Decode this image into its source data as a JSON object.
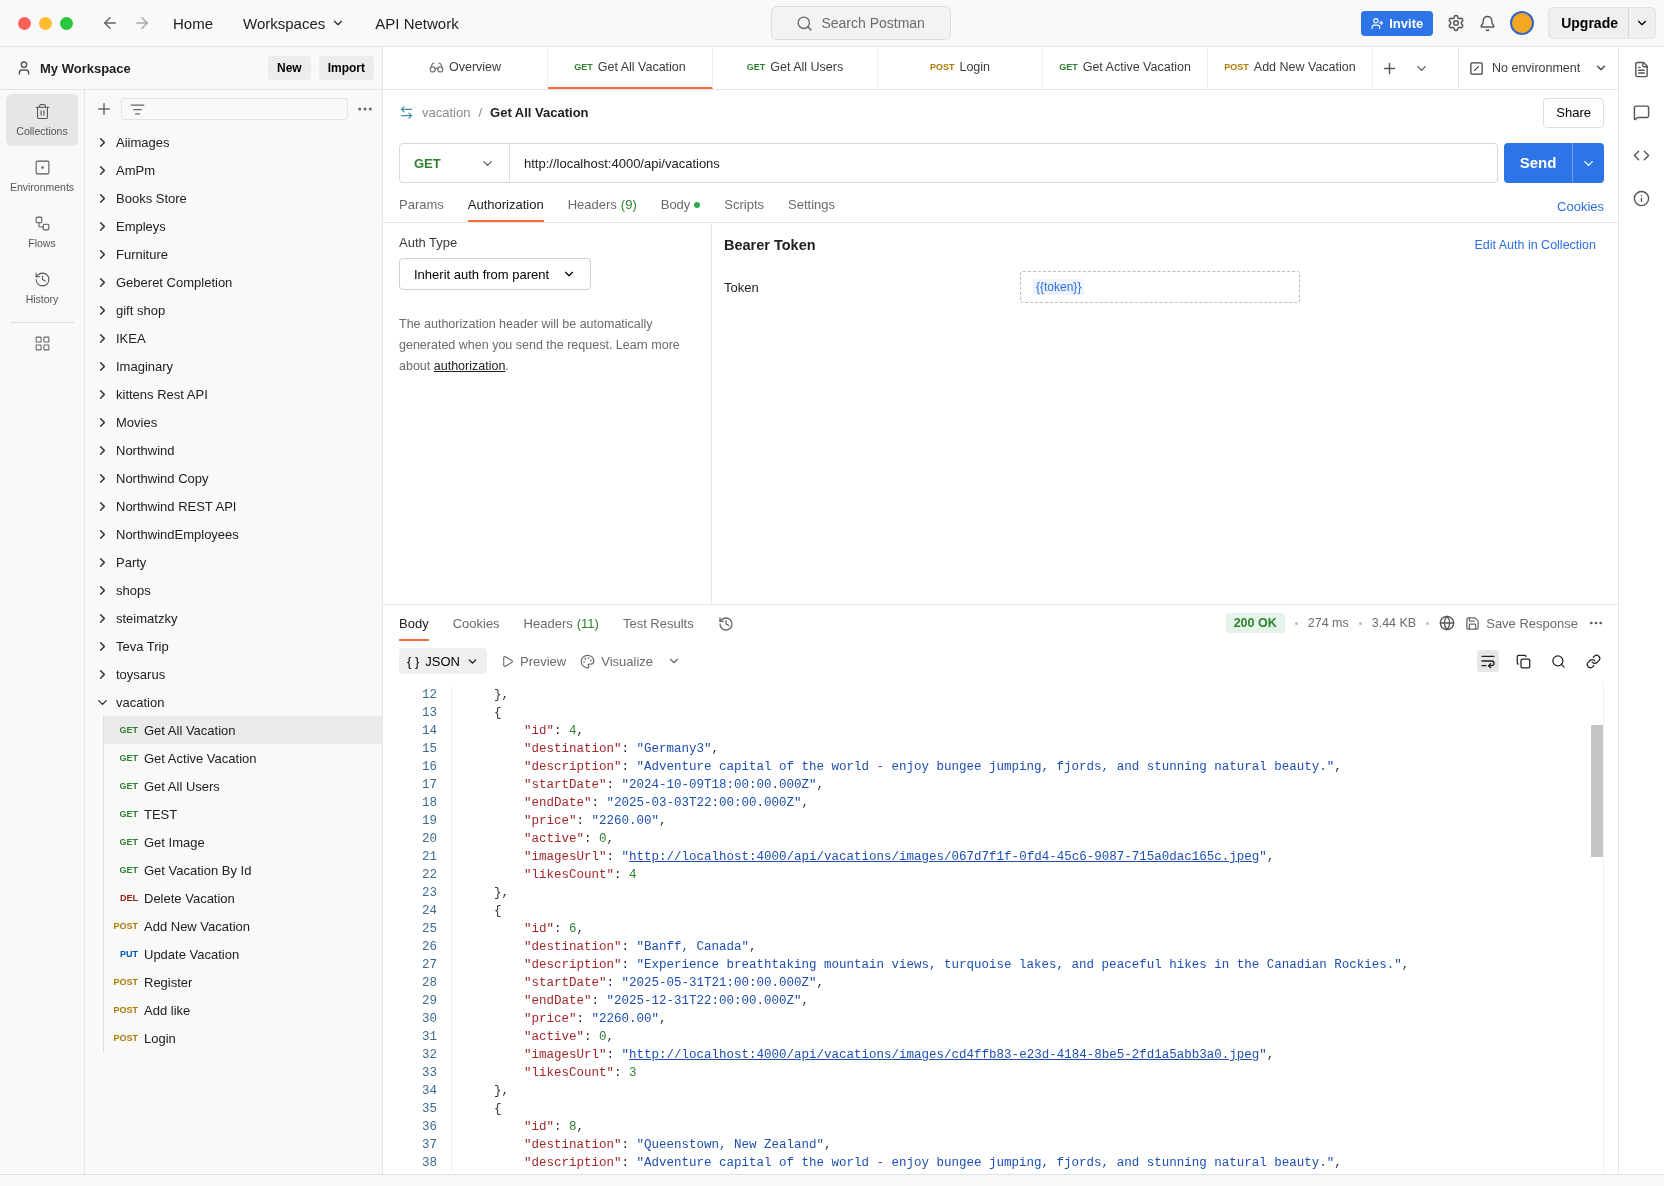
{
  "topbar": {
    "nav": [
      {
        "label": "Home",
        "dropdown": false
      },
      {
        "label": "Workspaces",
        "dropdown": true
      },
      {
        "label": "API Network",
        "dropdown": false
      }
    ],
    "search": {
      "placeholder": "Search Postman"
    },
    "invite": "Invite",
    "upgrade": "Upgrade"
  },
  "workspace": {
    "name": "My Workspace",
    "buttons": [
      "New",
      "Import"
    ]
  },
  "request_tabs": [
    {
      "kind": "overview",
      "label": "Overview",
      "selected": false
    },
    {
      "kind": "request",
      "method": "GET",
      "color": "#2f8132",
      "label": "Get All Vacation",
      "selected": true
    },
    {
      "kind": "request",
      "method": "GET",
      "color": "#2f8132",
      "label": "Get All Users",
      "selected": false
    },
    {
      "kind": "request",
      "method": "POST",
      "color": "#ad7a03",
      "label": "Login",
      "selected": false
    },
    {
      "kind": "request",
      "method": "GET",
      "color": "#2f8132",
      "label": "Get Active Vacation",
      "selected": false
    },
    {
      "kind": "request",
      "method": "POST",
      "color": "#ad7a03",
      "label": "Add New Vacation",
      "selected": false
    }
  ],
  "environment": "No environment",
  "sidebar": {
    "nav": [
      {
        "label": "Collections",
        "selected": true
      },
      {
        "label": "Environments",
        "selected": false
      },
      {
        "label": "Flows",
        "selected": false
      },
      {
        "label": "History",
        "selected": false
      }
    ],
    "collections": [
      {
        "name": "Aiimages",
        "expanded": false
      },
      {
        "name": "AmPm",
        "expanded": false
      },
      {
        "name": "Books Store",
        "expanded": false
      },
      {
        "name": "Empleys",
        "expanded": false
      },
      {
        "name": "Furniture",
        "expanded": false
      },
      {
        "name": "Geberet Completion",
        "expanded": false
      },
      {
        "name": "gift shop",
        "expanded": false
      },
      {
        "name": "IKEA",
        "expanded": false
      },
      {
        "name": "Imaginary",
        "expanded": false
      },
      {
        "name": "kittens Rest API",
        "expanded": false
      },
      {
        "name": "Movies",
        "expanded": false
      },
      {
        "name": "Northwind",
        "expanded": false
      },
      {
        "name": "Northwind Copy",
        "expanded": false
      },
      {
        "name": "Northwind REST API",
        "expanded": false
      },
      {
        "name": "NorthwindEmployees",
        "expanded": false
      },
      {
        "name": "Party",
        "expanded": false
      },
      {
        "name": "shops",
        "expanded": false
      },
      {
        "name": "steimatzky",
        "expanded": false
      },
      {
        "name": "Teva Trip",
        "expanded": false
      },
      {
        "name": "toysarus",
        "expanded": false
      },
      {
        "name": "vacation",
        "expanded": true,
        "children": [
          {
            "method": "GET",
            "color": "#2f8132",
            "name": "Get All Vacation",
            "selected": true
          },
          {
            "method": "GET",
            "color": "#2f8132",
            "name": "Get Active Vacation",
            "selected": false
          },
          {
            "method": "GET",
            "color": "#2f8132",
            "name": "Get All Users",
            "selected": false
          },
          {
            "method": "GET",
            "color": "#2f8132",
            "name": "TEST",
            "selected": false
          },
          {
            "method": "GET",
            "color": "#2f8132",
            "name": "Get Image",
            "selected": false
          },
          {
            "method": "GET",
            "color": "#2f8132",
            "name": "Get Vacation By Id",
            "selected": false
          },
          {
            "method": "DEL",
            "color": "#8e1a10",
            "name": "Delete Vacation",
            "selected": false
          },
          {
            "method": "POST",
            "color": "#ad7a03",
            "name": "Add New Vacation",
            "selected": false
          },
          {
            "method": "PUT",
            "color": "#0053b8",
            "name": "Update Vacation",
            "selected": false
          },
          {
            "method": "POST",
            "color": "#ad7a03",
            "name": "Register",
            "selected": false
          },
          {
            "method": "POST",
            "color": "#ad7a03",
            "name": "Add like",
            "selected": false
          },
          {
            "method": "POST",
            "color": "#ad7a03",
            "name": "Login",
            "selected": false
          }
        ]
      }
    ]
  },
  "request": {
    "breadcrumb": {
      "parent": "vacation",
      "separator": "/",
      "name": "Get All Vacation"
    },
    "share": "Share",
    "method": "GET",
    "url": "http://localhost:4000/api/vacations",
    "send": "Send",
    "tabs": [
      {
        "label": "Params",
        "selected": false,
        "modified": false
      },
      {
        "label": "Authorization",
        "selected": true,
        "modified": false
      },
      {
        "label": "Headers",
        "count": "(9)",
        "selected": false,
        "modified": false
      },
      {
        "label": "Body",
        "selected": false,
        "modified": true
      },
      {
        "label": "Scripts",
        "selected": false,
        "modified": false
      },
      {
        "label": "Settings",
        "selected": false,
        "modified": false
      }
    ],
    "cookies": "Cookies"
  },
  "auth": {
    "label": "Auth Type",
    "type": "Inherit auth from parent",
    "description": "The authorization header will be automatically generated when you send the request. Learn more about ",
    "link": "authorization",
    "description_end": ".",
    "heading": "Bearer Token",
    "edit_link": "Edit Auth in Collection",
    "token_label": "Token",
    "token_value": "{{token}}"
  },
  "response": {
    "tabs": [
      {
        "label": "Body",
        "selected": true
      },
      {
        "label": "Cookies",
        "selected": false
      },
      {
        "label": "Headers",
        "count": "(11)",
        "selected": false
      },
      {
        "label": "Test Results",
        "selected": false
      }
    ],
    "status": "200 OK",
    "time": "274 ms",
    "size": "3.44 KB",
    "save": "Save Response",
    "format_icon": "{ }",
    "format": "JSON",
    "preview": "Preview",
    "visualize": "Visualize",
    "lines": [
      {
        "number": "12",
        "tokens": [
          {
            "kind": "punct",
            "text": "    },"
          }
        ]
      },
      {
        "number": "13",
        "tokens": [
          {
            "kind": "punct",
            "text": "    {"
          }
        ]
      },
      {
        "number": "14",
        "tokens": [
          {
            "kind": "key",
            "text": "        \"id\""
          },
          {
            "kind": "punct",
            "text": ": "
          },
          {
            "kind": "number",
            "text": "4"
          },
          {
            "kind": "punct",
            "text": ","
          }
        ]
      },
      {
        "number": "15",
        "tokens": [
          {
            "kind": "key",
            "text": "        \"destination\""
          },
          {
            "kind": "punct",
            "text": ": "
          },
          {
            "kind": "string",
            "text": "\"Germany3\""
          },
          {
            "kind": "punct",
            "text": ","
          }
        ]
      },
      {
        "number": "16",
        "tokens": [
          {
            "kind": "key",
            "text": "        \"description\""
          },
          {
            "kind": "punct",
            "text": ": "
          },
          {
            "kind": "string",
            "text": "\"Adventure capital of the world - enjoy bungee jumping, fjords, and stunning natural beauty.\""
          },
          {
            "kind": "punct",
            "text": ","
          }
        ]
      },
      {
        "number": "17",
        "tokens": [
          {
            "kind": "key",
            "text": "        \"startDate\""
          },
          {
            "kind": "punct",
            "text": ": "
          },
          {
            "kind": "string",
            "text": "\"2024-10-09T18:00:00.000Z\""
          },
          {
            "kind": "punct",
            "text": ","
          }
        ]
      },
      {
        "number": "18",
        "tokens": [
          {
            "kind": "key",
            "text": "        \"endDate\""
          },
          {
            "kind": "punct",
            "text": ": "
          },
          {
            "kind": "string",
            "text": "\"2025-03-03T22:00:00.000Z\""
          },
          {
            "kind": "punct",
            "text": ","
          }
        ]
      },
      {
        "number": "19",
        "tokens": [
          {
            "kind": "key",
            "text": "        \"price\""
          },
          {
            "kind": "punct",
            "text": ": "
          },
          {
            "kind": "string",
            "text": "\"2260.00\""
          },
          {
            "kind": "punct",
            "text": ","
          }
        ]
      },
      {
        "number": "20",
        "tokens": [
          {
            "kind": "key",
            "text": "        \"active\""
          },
          {
            "kind": "punct",
            "text": ": "
          },
          {
            "kind": "number",
            "text": "0"
          },
          {
            "kind": "punct",
            "text": ","
          }
        ]
      },
      {
        "number": "21",
        "tokens": [
          {
            "kind": "key",
            "text": "        \"imagesUrl\""
          },
          {
            "kind": "punct",
            "text": ": "
          },
          {
            "kind": "string",
            "text": "\""
          },
          {
            "kind": "link",
            "text": "http://localhost:4000/api/vacations/images/067d7f1f-0fd4-45c6-9087-715a0dac165c.jpeg"
          },
          {
            "kind": "string",
            "text": "\""
          },
          {
            "kind": "punct",
            "text": ","
          }
        ]
      },
      {
        "number": "22",
        "tokens": [
          {
            "kind": "key",
            "text": "        \"likesCount\""
          },
          {
            "kind": "punct",
            "text": ": "
          },
          {
            "kind": "number",
            "text": "4"
          }
        ]
      },
      {
        "number": "23",
        "tokens": [
          {
            "kind": "punct",
            "text": "    },"
          }
        ]
      },
      {
        "number": "24",
        "tokens": [
          {
            "kind": "punct",
            "text": "    {"
          }
        ]
      },
      {
        "number": "25",
        "tokens": [
          {
            "kind": "key",
            "text": "        \"id\""
          },
          {
            "kind": "punct",
            "text": ": "
          },
          {
            "kind": "number",
            "text": "6"
          },
          {
            "kind": "punct",
            "text": ","
          }
        ]
      },
      {
        "number": "26",
        "tokens": [
          {
            "kind": "key",
            "text": "        \"destination\""
          },
          {
            "kind": "punct",
            "text": ": "
          },
          {
            "kind": "string",
            "text": "\"Banff, Canada\""
          },
          {
            "kind": "punct",
            "text": ","
          }
        ]
      },
      {
        "number": "27",
        "tokens": [
          {
            "kind": "key",
            "text": "        \"description\""
          },
          {
            "kind": "punct",
            "text": ": "
          },
          {
            "kind": "string",
            "text": "\"Experience breathtaking mountain views, turquoise lakes, and peaceful hikes in the Canadian Rockies.\""
          },
          {
            "kind": "punct",
            "text": ","
          }
        ]
      },
      {
        "number": "28",
        "tokens": [
          {
            "kind": "key",
            "text": "        \"startDate\""
          },
          {
            "kind": "punct",
            "text": ": "
          },
          {
            "kind": "string",
            "text": "\"2025-05-31T21:00:00.000Z\""
          },
          {
            "kind": "punct",
            "text": ","
          }
        ]
      },
      {
        "number": "29",
        "tokens": [
          {
            "kind": "key",
            "text": "        \"endDate\""
          },
          {
            "kind": "punct",
            "text": ": "
          },
          {
            "kind": "string",
            "text": "\"2025-12-31T22:00:00.000Z\""
          },
          {
            "kind": "punct",
            "text": ","
          }
        ]
      },
      {
        "number": "30",
        "tokens": [
          {
            "kind": "key",
            "text": "        \"price\""
          },
          {
            "kind": "punct",
            "text": ": "
          },
          {
            "kind": "string",
            "text": "\"2260.00\""
          },
          {
            "kind": "punct",
            "text": ","
          }
        ]
      },
      {
        "number": "31",
        "tokens": [
          {
            "kind": "key",
            "text": "        \"active\""
          },
          {
            "kind": "punct",
            "text": ": "
          },
          {
            "kind": "number",
            "text": "0"
          },
          {
            "kind": "punct",
            "text": ","
          }
        ]
      },
      {
        "number": "32",
        "tokens": [
          {
            "kind": "key",
            "text": "        \"imagesUrl\""
          },
          {
            "kind": "punct",
            "text": ": "
          },
          {
            "kind": "string",
            "text": "\""
          },
          {
            "kind": "link",
            "text": "http://localhost:4000/api/vacations/images/cd4ffb83-e23d-4184-8be5-2fd1a5abb3a0.jpeg"
          },
          {
            "kind": "string",
            "text": "\""
          },
          {
            "kind": "punct",
            "text": ","
          }
        ]
      },
      {
        "number": "33",
        "tokens": [
          {
            "kind": "key",
            "text": "        \"likesCount\""
          },
          {
            "kind": "punct",
            "text": ": "
          },
          {
            "kind": "number",
            "text": "3"
          }
        ]
      },
      {
        "number": "34",
        "tokens": [
          {
            "kind": "punct",
            "text": "    },"
          }
        ]
      },
      {
        "number": "35",
        "tokens": [
          {
            "kind": "punct",
            "text": "    {"
          }
        ]
      },
      {
        "number": "36",
        "tokens": [
          {
            "kind": "key",
            "text": "        \"id\""
          },
          {
            "kind": "punct",
            "text": ": "
          },
          {
            "kind": "number",
            "text": "8"
          },
          {
            "kind": "punct",
            "text": ","
          }
        ]
      },
      {
        "number": "37",
        "tokens": [
          {
            "kind": "key",
            "text": "        \"destination\""
          },
          {
            "kind": "punct",
            "text": ": "
          },
          {
            "kind": "string",
            "text": "\"Queenstown, New Zealand\""
          },
          {
            "kind": "punct",
            "text": ","
          }
        ]
      },
      {
        "number": "38",
        "tokens": [
          {
            "kind": "key",
            "text": "        \"description\""
          },
          {
            "kind": "punct",
            "text": ": "
          },
          {
            "kind": "string",
            "text": "\"Adventure capital of the world - enjoy bungee jumping, fjords, and stunning natural beauty.\""
          },
          {
            "kind": "punct",
            "text": ","
          }
        ]
      }
    ]
  }
}
